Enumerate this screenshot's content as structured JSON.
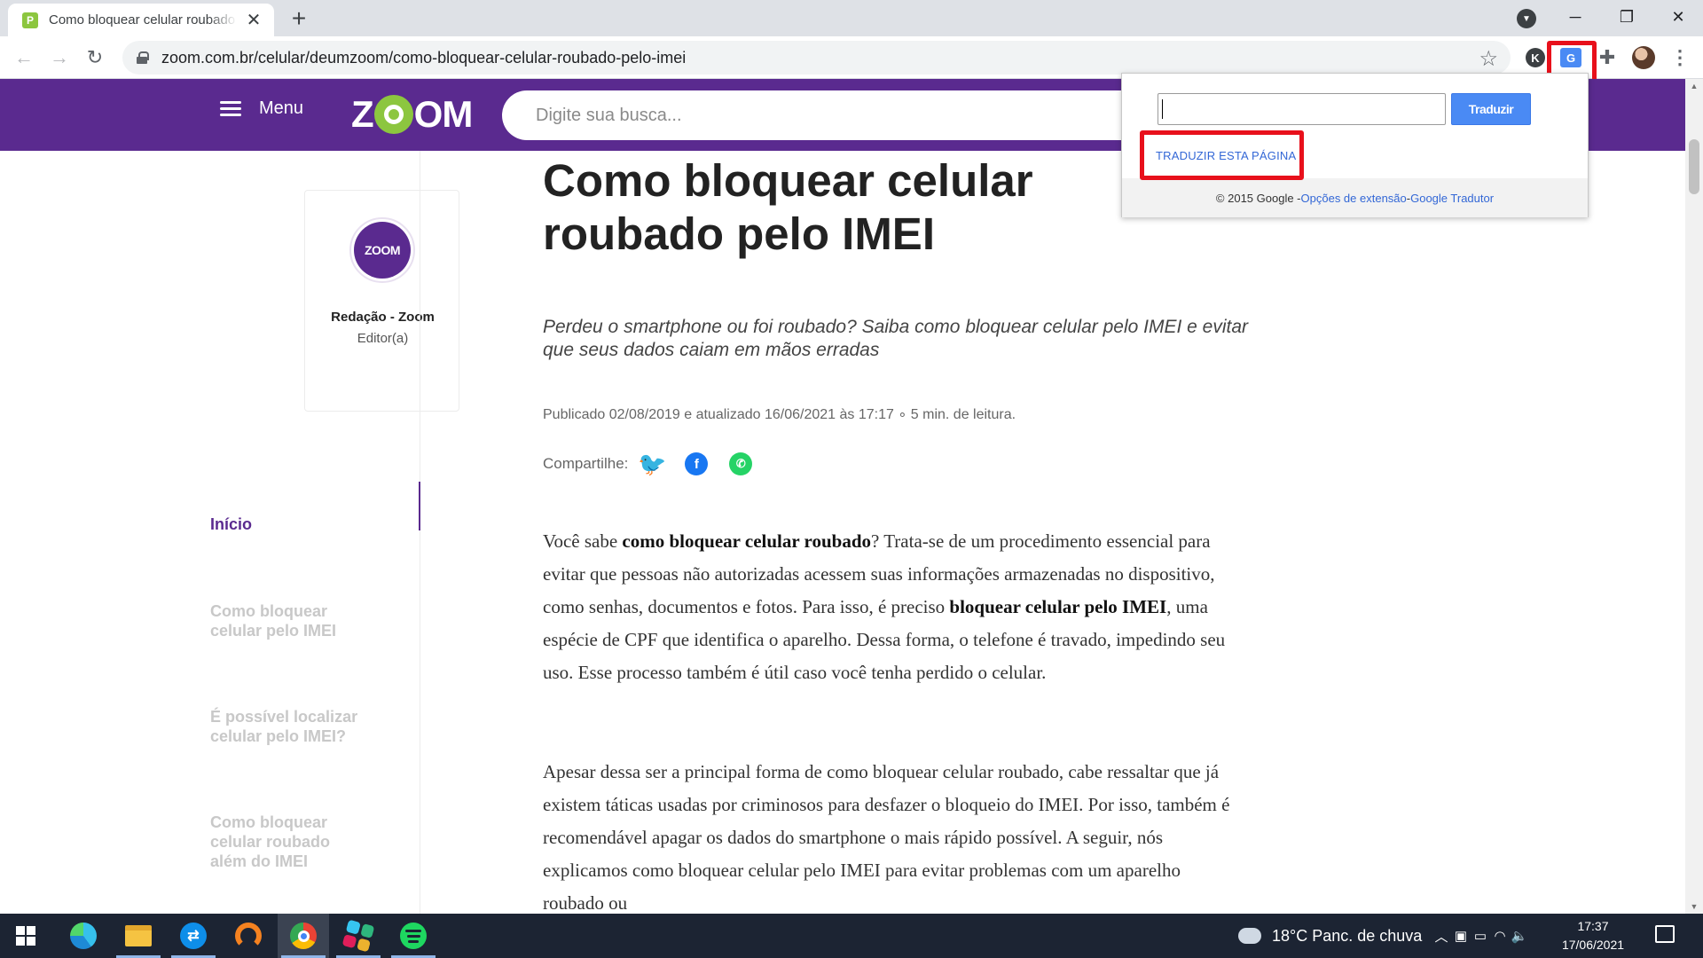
{
  "browser": {
    "tab_title": "Como bloquear celular roubado pelo IMEI",
    "tab_favicon": "P",
    "tab_close": "✕",
    "new_tab": "+",
    "url": "zoom.com.br/celular/deumzoom/como-bloquear-celular-roubado-pelo-imei",
    "ext_k_label": "K",
    "ext_translate_label": "G"
  },
  "site": {
    "menu_label": "Menu",
    "logo_left": "Z",
    "logo_right": "OM",
    "search_placeholder": "Digite sua busca..."
  },
  "translate_popup": {
    "input_value": "",
    "button_label": "Traduzir",
    "translate_page_link": "TRADUZIR ESTA PÁGINA",
    "footer_copyright": "© 2015 Google - ",
    "footer_options": "Opções de extensão",
    "footer_sep": " - ",
    "footer_translator": "Google Tradutor"
  },
  "author": {
    "avatar_text": "ZOOM",
    "name": "Redação - Zoom",
    "role": "Editor(a)"
  },
  "toc": [
    {
      "label": "Início",
      "active": true
    },
    {
      "label": "Como bloquear celular pelo IMEI",
      "active": false
    },
    {
      "label": "É possível localizar celular pelo IMEI?",
      "active": false
    },
    {
      "label": "Como bloquear celular roubado além do IMEI",
      "active": false
    }
  ],
  "article": {
    "title": "Como bloquear celular roubado pelo IMEI",
    "subtitle": "Perdeu o smartphone ou foi roubado? Saiba como bloquear celular pelo IMEI e evitar que seus dados caiam em mãos erradas",
    "meta": "Publicado 02/08/2019 e atualizado 16/06/2021 às 17:17 ∘ 5 min. de leitura.",
    "share_label": "Compartilhe:",
    "p1_a": "Você sabe ",
    "p1_b": "como bloquear celular roubado",
    "p1_c": "? Trata-se de um procedimento essencial para evitar que pessoas não autorizadas acessem suas informações armazenadas no dispositivo, como senhas, documentos e fotos. Para isso, é preciso ",
    "p1_d": "bloquear celular pelo IMEI",
    "p1_e": ", uma espécie de CPF que identifica o aparelho. Dessa forma, o telefone é travado, impedindo seu uso. Esse processo também é útil caso você tenha perdido o celular.",
    "p2": "Apesar dessa ser a principal forma de como bloquear celular roubado, cabe ressaltar que já existem táticas usadas por criminosos para desfazer o bloqueio do IMEI. Por isso, também é recomendável apagar os dados do smartphone o mais rápido possível. A seguir, nós explicamos como bloquear celular pelo IMEI para evitar problemas com um aparelho roubado ou"
  },
  "taskbar": {
    "weather": "18°C  Panc. de chuva",
    "time": "17:37",
    "date": "17/06/2021",
    "teamviewer_label": "⇄"
  },
  "colors": {
    "brand_purple": "#5a2a8f",
    "brand_green": "#8cc63f",
    "highlight_red": "#e8101b",
    "translate_blue": "#4a8af4"
  }
}
